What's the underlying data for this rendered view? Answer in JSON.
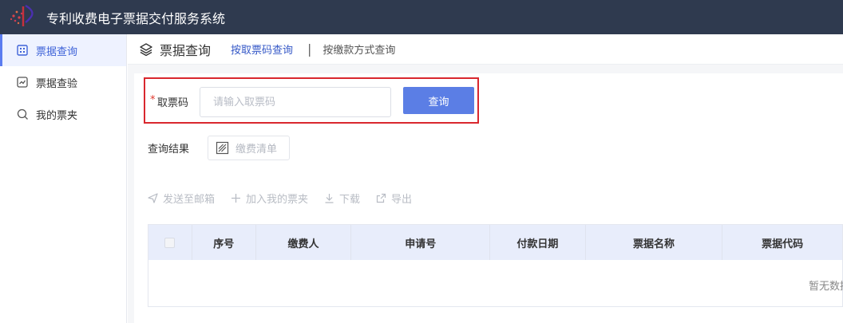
{
  "app": {
    "title": "专利收费电子票据交付服务系统"
  },
  "sidebar": {
    "items": [
      {
        "label": "票据查询",
        "icon": "receipt-list-icon",
        "active": true
      },
      {
        "label": "票据查验",
        "icon": "chart-check-icon",
        "active": false
      },
      {
        "label": "我的票夹",
        "icon": "search-icon",
        "active": false
      }
    ]
  },
  "header": {
    "page_title": "票据查询",
    "tabs": [
      {
        "label": "按取票码查询",
        "active": true
      },
      {
        "label": "按缴款方式查询",
        "active": false
      }
    ],
    "separator": "|"
  },
  "search": {
    "required_mark": "*",
    "label": "取票码",
    "placeholder": "请输入取票码",
    "value": "",
    "button": "查询"
  },
  "results": {
    "label": "查询结果",
    "fee_list_button": "缴费清单"
  },
  "actions": [
    {
      "label": "发送至邮箱",
      "icon": "send-icon"
    },
    {
      "label": "加入我的票夹",
      "icon": "plus-icon"
    },
    {
      "label": "下载",
      "icon": "download-icon"
    },
    {
      "label": "导出",
      "icon": "export-icon"
    }
  ],
  "table": {
    "columns": [
      "序号",
      "缴费人",
      "申请号",
      "付款日期",
      "票据名称",
      "票据代码"
    ],
    "rows": [],
    "empty_text": "暂无数据"
  },
  "colors": {
    "topbar": "#2f3a4f",
    "accent": "#5b7ee5",
    "highlight_border": "#d9272e",
    "table_header": "#e8edfb"
  }
}
